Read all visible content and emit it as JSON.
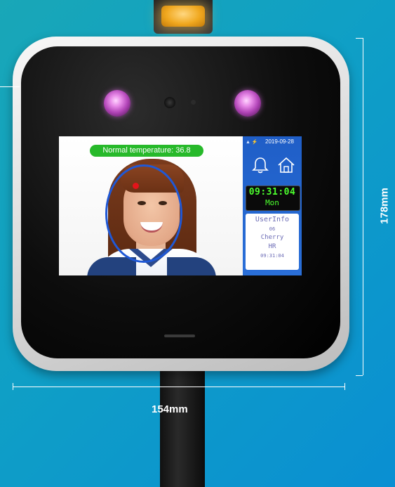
{
  "screen": {
    "temperature_banner": "Normal temperature: 36.8",
    "date": "2019-09-28",
    "status_icons": "▲ ⚡",
    "clock": "09:31:04",
    "day": "Mon",
    "user_info": {
      "title": "UserInfo",
      "id": "06",
      "name": "Cherry",
      "department": "HR",
      "time": "09:31:04"
    }
  },
  "dimensions": {
    "width": "154mm",
    "height": "178mm"
  },
  "colors": {
    "background": "#0f9fc6",
    "temperature_ok": "#27b92a",
    "face_outline": "#1f58d6",
    "clock_digits": "#4cff2e",
    "panel": "#1f5ec7"
  },
  "icons": [
    "bell-icon",
    "home-icon",
    "signal-icon"
  ]
}
